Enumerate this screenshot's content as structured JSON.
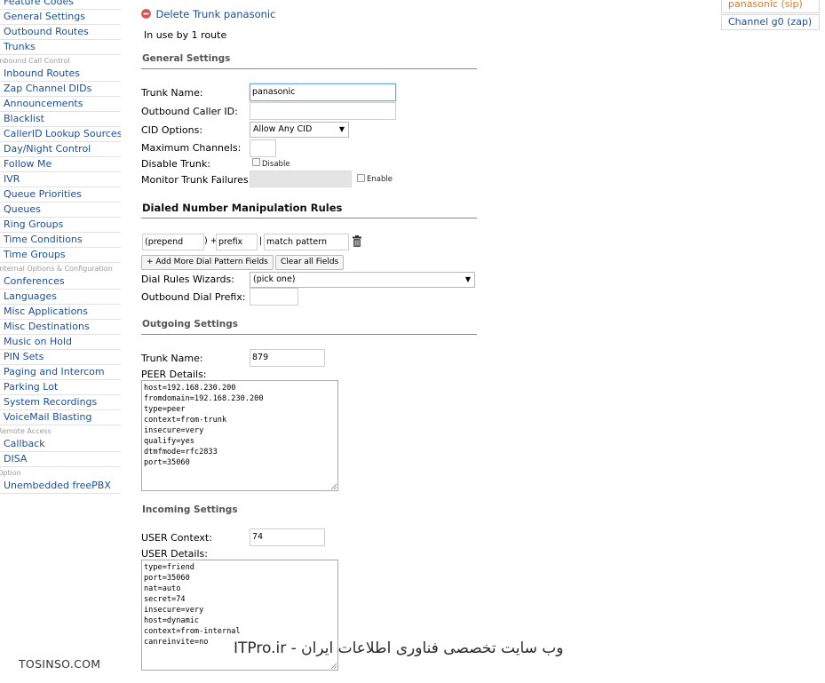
{
  "sidebar": {
    "items_top": [
      "Feature Codes",
      "General Settings",
      "Outbound Routes",
      "Trunks"
    ],
    "section_inbound": "Inbound Call Control",
    "items_inbound": [
      "Inbound Routes",
      "Zap Channel DIDs",
      "Announcements",
      "Blacklist",
      "CallerID Lookup Sources",
      "Day/Night Control",
      "Follow Me",
      "IVR",
      "Queue Priorities",
      "Queues",
      "Ring Groups",
      "Time Conditions",
      "Time Groups"
    ],
    "section_internal": "Internal Options & Configuration",
    "items_internal": [
      "Conferences",
      "Languages",
      "Misc Applications",
      "Misc Destinations",
      "Music on Hold",
      "PIN Sets",
      "Paging and Intercom",
      "Parking Lot",
      "System Recordings",
      "VoiceMail Blasting"
    ],
    "section_remote": "Remote Access",
    "items_remote": [
      "Callback",
      "DISA"
    ],
    "section_option": "Option",
    "items_option": [
      "Unembedded freePBX"
    ]
  },
  "trunk_list": {
    "active": "panasonic (sip)",
    "other": "Channel g0 (zap)"
  },
  "header": {
    "delete_link": "Delete Trunk panasonic",
    "in_use": "In use by 1 route"
  },
  "general": {
    "title": "General Settings",
    "trunk_name_label": "Trunk Name:",
    "trunk_name_value": "panasonic",
    "outbound_cid_label": "Outbound Caller ID:",
    "outbound_cid_value": "",
    "cid_options_label": "CID Options:",
    "cid_options_value": "Allow Any CID",
    "max_channels_label": "Maximum Channels:",
    "max_channels_value": "",
    "disable_trunk_label": "Disable Trunk:",
    "disable_checkbox_label": "Disable",
    "monitor_label": "Monitor Trunk Failures:",
    "monitor_value": "",
    "enable_checkbox_label": "Enable"
  },
  "dial_rules": {
    "title": "Dialed Number Manipulation Rules",
    "prepend_placeholder": "(prepend",
    "plus": ") +",
    "prefix_placeholder": "prefix",
    "pipe": "|",
    "match_placeholder": "match pattern",
    "add_button": "+ Add More Dial Pattern Fields",
    "clear_button": "Clear all Fields",
    "wizards_label": "Dial Rules Wizards:",
    "wizards_value": "(pick one)",
    "prefix_label": "Outbound Dial Prefix:",
    "prefix_value": ""
  },
  "outgoing": {
    "title": "Outgoing Settings",
    "trunk_name_label": "Trunk Name:",
    "trunk_name_value": "879",
    "peer_label": "PEER Details:",
    "peer_lines": [
      "host=192.168.230.200",
      "fromdomain=192.168.230.200",
      "type=peer",
      "context=from-trunk",
      "insecure=very",
      "qualify=yes",
      "dtmfmode=rfc2833",
      "port=35060"
    ]
  },
  "incoming": {
    "title": "Incoming Settings",
    "context_label": "USER Context:",
    "context_value": "74",
    "user_label": "USER Details:",
    "user_lines": [
      "type=friend",
      "port=35060",
      "nat=auto",
      "secret=74",
      "insecure=very",
      "host=dynamic",
      "context=from-internal",
      "canreinvite=no"
    ]
  },
  "watermarks": {
    "left": "TOSINSO.COM",
    "right": "ITPro.ir - وب سایت تخصصی فناوری اطلاعات ایران"
  },
  "colors": {
    "link": "#1a4f9c",
    "active_trunk": "#e07a26",
    "delete_icon": "#d9534f"
  }
}
